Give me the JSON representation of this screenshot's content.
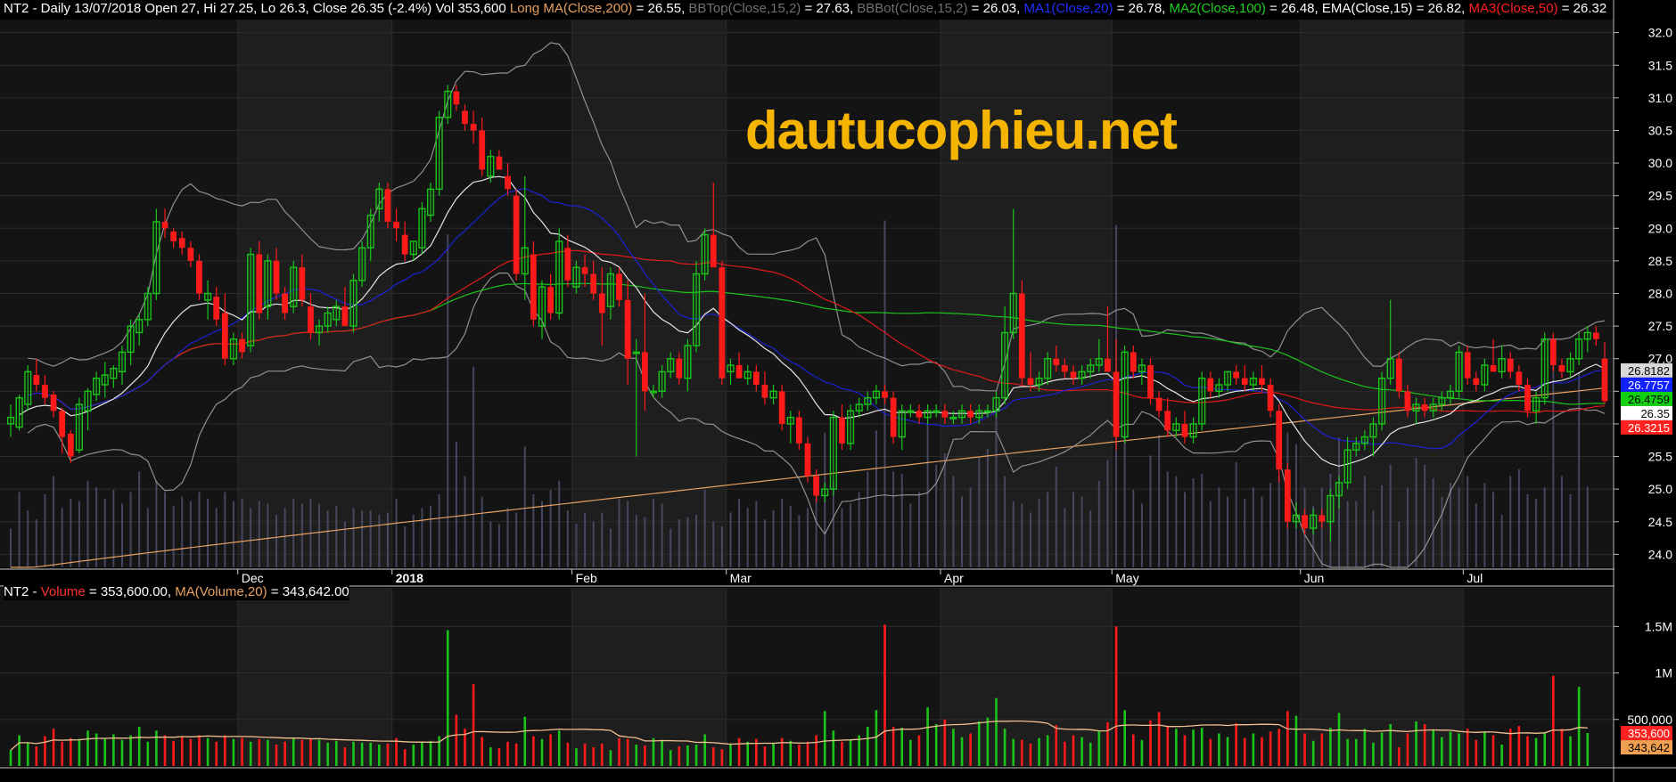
{
  "header": {
    "main": [
      {
        "text": "NT2 - Daily 13/07/2018 Open 27, Hi 27.25, Lo 26.3, Close 26.35 (-2.4%) Vol 353,600 ",
        "color": "#ffffff"
      },
      {
        "text": "Long MA(Close,200)",
        "color": "#e8a060"
      },
      {
        "text": " = 26.55, ",
        "color": "#ffffff"
      },
      {
        "text": "BBTop(Close,15,2)",
        "color": "#707070"
      },
      {
        "text": " = 27.63, ",
        "color": "#ffffff"
      },
      {
        "text": "BBBot(Close,15,2)",
        "color": "#707070"
      },
      {
        "text": " = 26.03, ",
        "color": "#ffffff"
      },
      {
        "text": "MA1(Close,20)",
        "color": "#2030ff"
      },
      {
        "text": " = 26.78, ",
        "color": "#ffffff"
      },
      {
        "text": "MA2(Close,100)",
        "color": "#20d020"
      },
      {
        "text": " = 26.48, EMA(Close,15) = 26.82, ",
        "color": "#ffffff"
      },
      {
        "text": "MA3(Close,50)",
        "color": "#ff2020"
      },
      {
        "text": " = 26.32",
        "color": "#ffffff"
      }
    ],
    "volume": [
      {
        "text": "NT2 - ",
        "color": "#ffffff"
      },
      {
        "text": "Volume",
        "color": "#ff3030"
      },
      {
        "text": " = 353,600.00, ",
        "color": "#ffffff"
      },
      {
        "text": "MA(Volume,20)",
        "color": "#e8a060"
      },
      {
        "text": " = 343,642.00",
        "color": "#ffffff"
      }
    ]
  },
  "watermark": "dautucophieu.net",
  "price_axis": [
    "32.0",
    "31.5",
    "31.0",
    "30.5",
    "30.0",
    "29.5",
    "29.0",
    "28.5",
    "28.0",
    "27.5",
    "27.0",
    "26.5",
    "26.0",
    "25.5",
    "25.0",
    "24.5",
    "24.0"
  ],
  "price_badges": [
    {
      "text": "26.8182",
      "value": 26.82,
      "bg": "#d8d8d8",
      "fg": "#000000"
    },
    {
      "text": "26.7757",
      "value": 26.78,
      "bg": "#1020ff",
      "fg": "#ffffff"
    },
    {
      "text": "26.4759",
      "value": 26.48,
      "bg": "#10d010",
      "fg": "#000000"
    },
    {
      "text": "26.35",
      "value": 26.35,
      "bg": "#ffffff",
      "fg": "#000000"
    },
    {
      "text": "26.3215",
      "value": 26.32,
      "bg": "#ff2020",
      "fg": "#ffffff"
    }
  ],
  "volume_axis": [
    "1.5M",
    "1M",
    "500,000"
  ],
  "volume_badges": [
    {
      "text": "353,600",
      "value": 353600,
      "bg": "#ff2020",
      "fg": "#ffffff"
    },
    {
      "text": "343,642",
      "value": 343642,
      "bg": "#f0a050",
      "fg": "#000000"
    }
  ],
  "months": [
    {
      "label": "Dec",
      "day": 27,
      "bold": false
    },
    {
      "label": "2018",
      "day": 45,
      "bold": true
    },
    {
      "label": "Feb",
      "day": 66,
      "bold": false
    },
    {
      "label": "Mar",
      "day": 84,
      "bold": false
    },
    {
      "label": "Apr",
      "day": 109,
      "bold": false
    },
    {
      "label": "May",
      "day": 129,
      "bold": false
    },
    {
      "label": "Jun",
      "day": 151,
      "bold": false
    },
    {
      "label": "Jul",
      "day": 170,
      "bold": false
    }
  ],
  "colors": {
    "up": "#19c519",
    "down": "#ff1a1a",
    "bb": "#909090",
    "ma20": "#1a22d6",
    "ma100": "#19c519",
    "ema15": "#e6e6e6",
    "ma50": "#e01a1a",
    "ma200": "#e8a060",
    "vol_ma": "#f0c090",
    "grid": "#2b2b2b"
  },
  "chart_data": {
    "type": "candlestick",
    "symbol": "NT2",
    "ylim": [
      23.8,
      32.2
    ],
    "candles": [
      [
        26.0,
        26.3,
        25.8,
        26.1
      ],
      [
        25.95,
        26.45,
        25.9,
        26.4
      ],
      [
        26.3,
        26.9,
        26.2,
        26.8
      ],
      [
        26.75,
        27.0,
        26.5,
        26.6
      ],
      [
        26.6,
        26.75,
        26.3,
        26.4
      ],
      [
        26.45,
        26.5,
        26.1,
        26.2
      ],
      [
        26.2,
        26.25,
        25.55,
        25.8
      ],
      [
        25.85,
        25.9,
        25.4,
        25.5
      ],
      [
        25.6,
        26.4,
        25.55,
        26.3
      ],
      [
        26.2,
        26.55,
        25.9,
        26.5
      ],
      [
        26.45,
        26.8,
        26.35,
        26.7
      ],
      [
        26.6,
        26.95,
        26.4,
        26.75
      ],
      [
        26.7,
        26.9,
        26.55,
        26.85
      ],
      [
        26.8,
        27.2,
        26.6,
        27.1
      ],
      [
        27.1,
        27.6,
        26.9,
        27.5
      ],
      [
        27.4,
        27.7,
        27.2,
        27.6
      ],
      [
        27.6,
        28.1,
        27.5,
        28.0
      ],
      [
        28.0,
        29.3,
        27.9,
        29.1
      ],
      [
        29.1,
        29.3,
        28.85,
        29.0
      ],
      [
        28.95,
        29.0,
        28.7,
        28.8
      ],
      [
        28.85,
        28.95,
        28.6,
        28.7
      ],
      [
        28.7,
        28.8,
        28.4,
        28.5
      ],
      [
        28.5,
        28.6,
        27.9,
        28.0
      ],
      [
        27.9,
        28.2,
        27.6,
        28.0
      ],
      [
        27.95,
        28.1,
        27.5,
        27.6
      ],
      [
        27.7,
        28.0,
        26.9,
        27.0
      ],
      [
        27.0,
        27.4,
        26.9,
        27.3
      ],
      [
        27.3,
        27.4,
        27.0,
        27.1
      ],
      [
        27.2,
        28.7,
        27.1,
        28.6
      ],
      [
        28.6,
        28.8,
        27.6,
        27.7
      ],
      [
        27.8,
        28.6,
        27.6,
        28.5
      ],
      [
        28.5,
        28.7,
        27.9,
        28.0
      ],
      [
        28.0,
        28.1,
        27.6,
        27.7
      ],
      [
        27.8,
        28.5,
        27.7,
        28.4
      ],
      [
        28.4,
        28.6,
        27.8,
        27.9
      ],
      [
        27.8,
        28.0,
        27.3,
        27.4
      ],
      [
        27.4,
        27.6,
        27.2,
        27.5
      ],
      [
        27.5,
        27.8,
        27.4,
        27.7
      ],
      [
        27.6,
        27.9,
        27.5,
        27.8
      ],
      [
        27.8,
        28.1,
        27.5,
        27.5
      ],
      [
        27.5,
        28.3,
        27.4,
        28.2
      ],
      [
        28.2,
        28.8,
        28.1,
        28.7
      ],
      [
        28.7,
        29.3,
        28.5,
        29.2
      ],
      [
        29.3,
        29.7,
        29.1,
        29.6
      ],
      [
        29.6,
        29.7,
        29.0,
        29.1
      ],
      [
        29.1,
        29.3,
        28.8,
        29.0
      ],
      [
        28.9,
        29.1,
        28.5,
        28.6
      ],
      [
        28.6,
        28.8,
        28.5,
        28.8
      ],
      [
        28.7,
        29.4,
        28.6,
        29.3
      ],
      [
        29.2,
        29.7,
        29.1,
        29.6
      ],
      [
        29.6,
        30.8,
        29.5,
        30.7
      ],
      [
        30.7,
        31.2,
        30.6,
        31.1
      ],
      [
        31.1,
        31.2,
        30.8,
        30.9
      ],
      [
        30.8,
        30.9,
        30.5,
        30.6
      ],
      [
        30.6,
        30.8,
        30.3,
        30.5
      ],
      [
        30.5,
        30.7,
        29.8,
        29.9
      ],
      [
        29.8,
        30.2,
        29.7,
        30.1
      ],
      [
        30.1,
        30.2,
        29.9,
        29.9
      ],
      [
        29.8,
        30.0,
        29.5,
        29.6
      ],
      [
        29.5,
        29.6,
        28.2,
        28.3
      ],
      [
        28.3,
        29.8,
        27.9,
        28.7
      ],
      [
        28.6,
        28.8,
        27.5,
        27.6
      ],
      [
        27.5,
        28.2,
        27.3,
        28.1
      ],
      [
        28.1,
        28.3,
        27.6,
        27.7
      ],
      [
        27.7,
        29.0,
        27.6,
        28.8
      ],
      [
        28.7,
        28.9,
        28.1,
        28.2
      ],
      [
        28.1,
        28.5,
        28.0,
        28.4
      ],
      [
        28.4,
        28.6,
        28.1,
        28.3
      ],
      [
        28.3,
        28.5,
        27.9,
        28.0
      ],
      [
        28.0,
        28.4,
        27.2,
        27.7
      ],
      [
        27.8,
        28.4,
        27.6,
        28.3
      ],
      [
        28.3,
        28.4,
        27.8,
        27.9
      ],
      [
        27.9,
        28.2,
        26.6,
        27.0
      ],
      [
        27.1,
        27.3,
        25.5,
        27.1
      ],
      [
        27.1,
        28.0,
        26.2,
        26.5
      ],
      [
        26.5,
        26.6,
        26.4,
        26.5
      ],
      [
        26.5,
        26.9,
        26.4,
        26.8
      ],
      [
        26.8,
        27.1,
        26.7,
        27.0
      ],
      [
        27.0,
        27.1,
        26.6,
        26.7
      ],
      [
        26.7,
        27.3,
        26.5,
        27.2
      ],
      [
        27.2,
        28.5,
        27.1,
        28.3
      ],
      [
        28.3,
        29.0,
        28.2,
        28.9
      ],
      [
        28.9,
        29.7,
        28.8,
        28.4
      ],
      [
        28.4,
        28.5,
        26.6,
        26.7
      ],
      [
        26.8,
        27.0,
        26.6,
        26.9
      ],
      [
        26.9,
        27.1,
        26.7,
        26.7
      ],
      [
        26.7,
        26.9,
        26.6,
        26.8
      ],
      [
        26.8,
        26.9,
        26.5,
        26.6
      ],
      [
        26.6,
        26.8,
        26.3,
        26.4
      ],
      [
        26.4,
        26.6,
        26.3,
        26.5
      ],
      [
        26.5,
        26.6,
        25.9,
        26.0
      ],
      [
        26.0,
        26.2,
        25.7,
        26.1
      ],
      [
        26.1,
        26.2,
        25.6,
        25.7
      ],
      [
        25.7,
        25.8,
        25.1,
        25.2
      ],
      [
        25.2,
        25.3,
        24.8,
        24.9
      ],
      [
        24.9,
        25.1,
        24.8,
        25.0
      ],
      [
        25.0,
        26.2,
        24.9,
        26.1
      ],
      [
        26.1,
        26.3,
        25.6,
        25.7
      ],
      [
        25.7,
        26.3,
        25.6,
        26.2
      ],
      [
        26.2,
        26.4,
        26.1,
        26.3
      ],
      [
        26.3,
        26.5,
        26.2,
        26.4
      ],
      [
        26.4,
        26.6,
        26.3,
        26.5
      ],
      [
        26.5,
        26.6,
        26.3,
        26.4
      ],
      [
        26.4,
        26.5,
        25.7,
        25.8
      ],
      [
        25.8,
        26.3,
        25.6,
        26.2
      ],
      [
        26.2,
        26.3,
        26.1,
        26.2
      ],
      [
        26.2,
        26.3,
        26.0,
        26.1
      ],
      [
        26.1,
        26.3,
        26.0,
        26.2
      ],
      [
        26.2,
        26.3,
        26.1,
        26.2
      ],
      [
        26.2,
        26.3,
        26.0,
        26.1
      ],
      [
        26.1,
        26.2,
        26.0,
        26.1
      ],
      [
        26.1,
        26.3,
        26.0,
        26.2
      ],
      [
        26.2,
        26.3,
        26.0,
        26.1
      ],
      [
        26.1,
        26.3,
        26.0,
        26.2
      ],
      [
        26.2,
        26.3,
        26.1,
        26.2
      ],
      [
        26.2,
        26.5,
        26.1,
        26.4
      ],
      [
        26.4,
        27.8,
        26.3,
        27.4
      ],
      [
        27.4,
        29.3,
        27.3,
        28.0
      ],
      [
        28.0,
        28.2,
        26.6,
        26.7
      ],
      [
        26.7,
        27.1,
        26.5,
        26.6
      ],
      [
        26.6,
        26.8,
        26.5,
        26.7
      ],
      [
        26.7,
        27.1,
        26.6,
        27.0
      ],
      [
        27.0,
        27.2,
        26.8,
        26.9
      ],
      [
        26.9,
        27.0,
        26.7,
        26.8
      ],
      [
        26.8,
        26.9,
        26.6,
        26.7
      ],
      [
        26.7,
        26.9,
        26.6,
        26.8
      ],
      [
        26.8,
        27.0,
        26.7,
        26.9
      ],
      [
        26.9,
        27.3,
        26.8,
        27.0
      ],
      [
        27.0,
        27.8,
        26.9,
        26.8
      ],
      [
        26.8,
        27.3,
        25.6,
        25.8
      ],
      [
        25.8,
        27.2,
        25.7,
        27.1
      ],
      [
        27.1,
        27.2,
        26.7,
        26.8
      ],
      [
        26.8,
        27.0,
        26.6,
        26.9
      ],
      [
        26.9,
        27.0,
        26.3,
        26.4
      ],
      [
        26.4,
        26.5,
        26.1,
        26.2
      ],
      [
        26.2,
        26.4,
        25.8,
        25.9
      ],
      [
        25.9,
        26.1,
        25.8,
        26.0
      ],
      [
        26.0,
        26.2,
        25.7,
        25.8
      ],
      [
        25.8,
        26.1,
        25.7,
        26.0
      ],
      [
        26.0,
        26.8,
        25.9,
        26.7
      ],
      [
        26.7,
        26.8,
        26.4,
        26.5
      ],
      [
        26.5,
        26.7,
        26.4,
        26.6
      ],
      [
        26.6,
        26.8,
        26.5,
        26.8
      ],
      [
        26.8,
        26.9,
        26.6,
        26.7
      ],
      [
        26.7,
        26.9,
        26.5,
        26.6
      ],
      [
        26.6,
        26.8,
        26.5,
        26.7
      ],
      [
        26.7,
        26.9,
        26.5,
        26.6
      ],
      [
        26.6,
        26.7,
        26.1,
        26.2
      ],
      [
        26.2,
        26.3,
        25.1,
        25.3
      ],
      [
        25.3,
        25.4,
        24.4,
        24.5
      ],
      [
        24.5,
        24.8,
        24.4,
        24.6
      ],
      [
        24.6,
        24.7,
        24.3,
        24.4
      ],
      [
        24.4,
        24.7,
        24.3,
        24.6
      ],
      [
        24.6,
        24.7,
        24.4,
        24.5
      ],
      [
        24.5,
        25.0,
        24.2,
        24.9
      ],
      [
        24.9,
        25.2,
        24.7,
        25.1
      ],
      [
        25.1,
        25.8,
        25.0,
        25.6
      ],
      [
        25.6,
        25.8,
        25.5,
        25.7
      ],
      [
        25.7,
        25.9,
        25.6,
        25.8
      ],
      [
        25.8,
        26.1,
        25.5,
        26.0
      ],
      [
        26.0,
        26.8,
        25.9,
        26.7
      ],
      [
        26.7,
        27.9,
        26.6,
        27.0
      ],
      [
        27.0,
        27.1,
        26.4,
        26.5
      ],
      [
        26.5,
        26.6,
        26.1,
        26.2
      ],
      [
        26.2,
        26.4,
        26.0,
        26.3
      ],
      [
        26.3,
        26.4,
        26.1,
        26.2
      ],
      [
        26.2,
        26.4,
        26.1,
        26.3
      ],
      [
        26.3,
        26.5,
        26.2,
        26.4
      ],
      [
        26.4,
        26.6,
        26.3,
        26.5
      ],
      [
        26.5,
        27.2,
        26.4,
        27.1
      ],
      [
        27.1,
        27.2,
        26.6,
        26.7
      ],
      [
        26.7,
        26.8,
        26.5,
        26.6
      ],
      [
        26.6,
        27.0,
        26.5,
        26.9
      ],
      [
        26.9,
        27.3,
        26.8,
        26.8
      ],
      [
        26.8,
        27.2,
        26.7,
        27.0
      ],
      [
        27.0,
        27.1,
        26.7,
        26.8
      ],
      [
        26.8,
        26.9,
        26.5,
        26.6
      ],
      [
        26.6,
        26.7,
        26.1,
        26.2
      ],
      [
        26.2,
        26.5,
        26.0,
        26.4
      ],
      [
        26.4,
        27.4,
        26.3,
        27.3
      ],
      [
        27.3,
        27.4,
        26.8,
        26.9
      ],
      [
        26.9,
        27.0,
        26.7,
        26.8
      ],
      [
        26.8,
        27.1,
        26.7,
        27.0
      ],
      [
        27.0,
        27.4,
        26.9,
        27.3
      ],
      [
        27.3,
        27.5,
        27.1,
        27.4
      ],
      [
        27.4,
        27.5,
        27.2,
        27.3
      ],
      [
        27.0,
        27.25,
        26.3,
        26.35
      ]
    ],
    "volume": [
      170000,
      330000,
      250000,
      210000,
      320000,
      400000,
      260000,
      300000,
      290000,
      380000,
      350000,
      300000,
      340000,
      280000,
      330000,
      420000,
      260000,
      380000,
      330000,
      270000,
      310000,
      290000,
      330000,
      300000,
      260000,
      330000,
      290000,
      300000,
      260000,
      290000,
      280000,
      230000,
      260000,
      300000,
      280000,
      300000,
      280000,
      250000,
      270000,
      200000,
      260000,
      250000,
      250000,
      230000,
      240000,
      300000,
      180000,
      230000,
      260000,
      270000,
      320000,
      1460000,
      550000,
      400000,
      880000,
      310000,
      200000,
      190000,
      260000,
      240000,
      530000,
      320000,
      290000,
      340000,
      380000,
      250000,
      190000,
      240000,
      200000,
      240000,
      170000,
      300000,
      290000,
      230000,
      220000,
      300000,
      280000,
      170000,
      210000,
      220000,
      230000,
      340000,
      200000,
      180000,
      240000,
      300000,
      260000,
      290000,
      210000,
      250000,
      300000,
      270000,
      230000,
      260000,
      330000,
      590000,
      380000,
      260000,
      280000,
      330000,
      420000,
      600000,
      1520000,
      420000,
      410000,
      280000,
      330000,
      630000,
      450000,
      500000,
      400000,
      310000,
      350000,
      480000,
      520000,
      730000,
      400000,
      290000,
      280000,
      240000,
      300000,
      330000,
      440000,
      260000,
      330000,
      310000,
      250000,
      380000,
      470000,
      1500000,
      600000,
      340000,
      280000,
      490000,
      580000,
      420000,
      400000,
      330000,
      390000,
      410000,
      290000,
      350000,
      310000,
      460000,
      300000,
      350000,
      310000,
      370000,
      400000,
      590000,
      540000,
      350000,
      270000,
      350000,
      410000,
      570000,
      290000,
      290000,
      400000,
      250000,
      360000,
      450000,
      200000,
      350000,
      480000,
      450000,
      390000,
      310000,
      370000,
      350000,
      400000,
      280000,
      370000,
      330000,
      230000,
      400000,
      430000,
      320000,
      300000,
      350000,
      970000,
      400000,
      320000,
      850000,
      353600
    ],
    "volume_max": 1800000
  }
}
